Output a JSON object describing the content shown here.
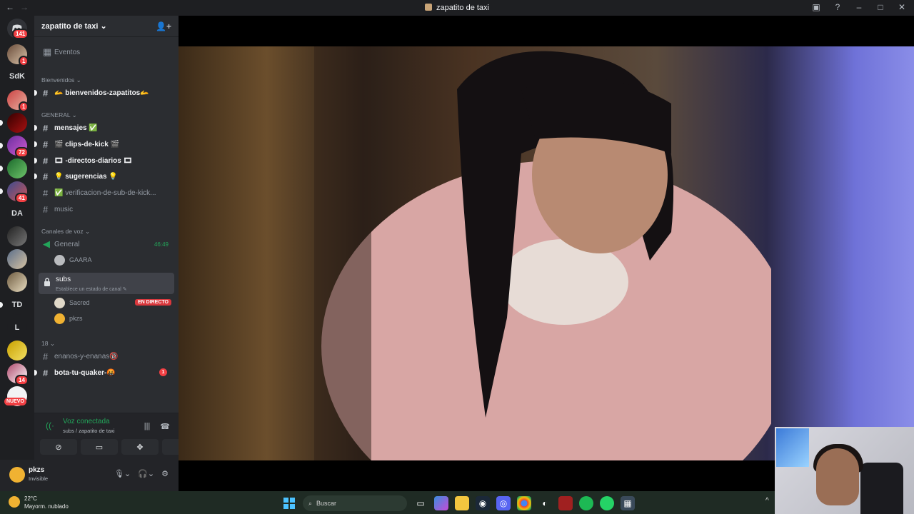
{
  "window": {
    "title": "zapatito de taxi"
  },
  "server": {
    "name": "zapatito de taxi"
  },
  "rail": {
    "home_badge": "141",
    "badges": {
      "s1": "1",
      "s2": "1",
      "s4": "72",
      "s6": "41",
      "s12": "14"
    },
    "text_servers": {
      "sdk": "SdK",
      "da": "DA",
      "td": "TD",
      "l": "L"
    },
    "nuevo": "NUEVO"
  },
  "sidebar": {
    "events": "Eventos",
    "categories": {
      "bienvenidos": "Bienvenidos",
      "general": "GENERAL",
      "voz": "Canales de voz",
      "c18": "18"
    },
    "channels": {
      "bienvenidos": "🫴 bienvenidos-zapatitos🫴",
      "mensajes": "mensajes ✅",
      "clips": "🎬 clips-de-kick 🎬",
      "directos": "🎞 -directos-diarios 🎞",
      "sugerencias": "💡 sugerencias 💡",
      "verificacion": "✅ verificacion-de-sub-de-kick...",
      "music": "music",
      "enanos": "enanos-y-enanas🔞",
      "bota": "bota-tu-quaker-🤬"
    },
    "bota_badge": "1",
    "voice": {
      "general": "General",
      "general_timer": "46:49",
      "general_user": "GAARA",
      "subs": "subs",
      "subs_status": "Establece un estado de canal ✎",
      "subs_users": [
        {
          "name": "Sacred",
          "live": "EN DIRECTO"
        },
        {
          "name": "pkzs"
        }
      ]
    }
  },
  "voice_panel": {
    "status": "Voz conectada",
    "location": "subs / zapatito de taxi"
  },
  "user_panel": {
    "name": "pkzs",
    "status": "Invisible"
  },
  "taskbar": {
    "temp": "22°C",
    "weather": "Mayorm. nublado",
    "search": "Buscar"
  }
}
